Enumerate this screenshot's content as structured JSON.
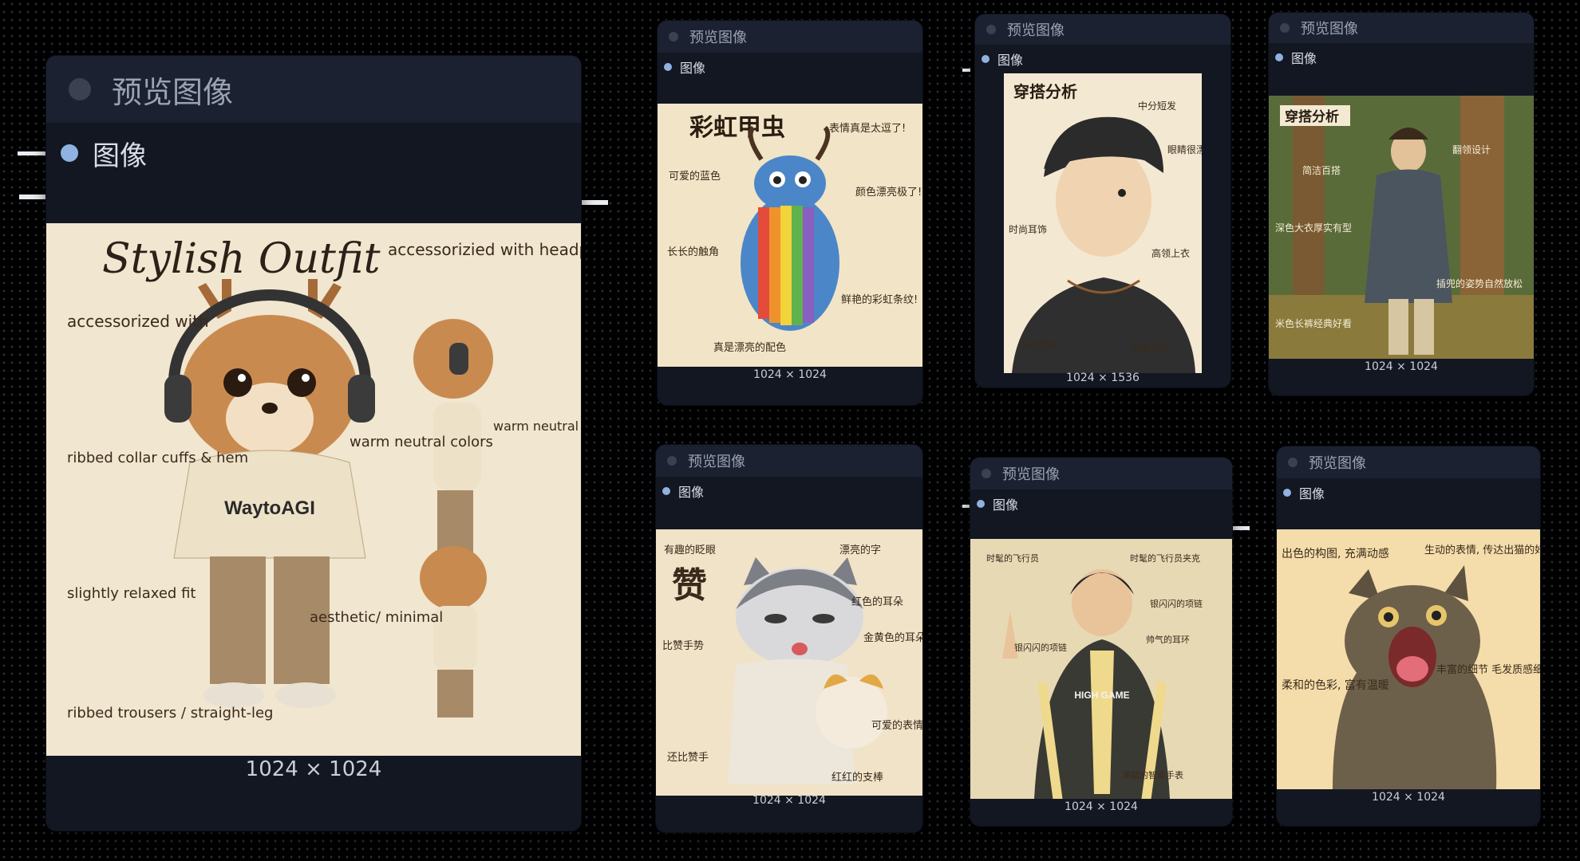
{
  "nodes": [
    {
      "title": "预览图像",
      "port_label": "图像",
      "size": "1024 × 1024",
      "image": {
        "title": "Stylish Outfit",
        "brand": "WaytoAGI",
        "notes": [
          "accessorizied with headphones",
          "accessorized with",
          "ribbed collar cuffs & hem",
          "warm neutral colors",
          "warm neutral colors",
          "slightly relaxed fit",
          "aesthetic/ minimal",
          "ribbed trousers / straight-leg"
        ]
      }
    },
    {
      "title": "预览图像",
      "port_label": "图像",
      "size": "1024 × 1024",
      "image": {
        "title": "彩虹甲虫",
        "notes": [
          "表情真是太逗了!",
          "可爱的蓝色",
          "颜色漂亮极了!",
          "长长的触角",
          "鲜艳的彩虹条纹!",
          "真是漂亮的配色"
        ]
      }
    },
    {
      "title": "预览图像",
      "port_label": "图像",
      "size": "1024 × 1536",
      "image": {
        "title": "穿搭分析",
        "notes": [
          "中分短发",
          "眼睛很漂亮",
          "时尚耳饰",
          "高领上衣",
          "时尚耳饰",
          "简单好看"
        ]
      }
    },
    {
      "title": "预览图像",
      "port_label": "图像",
      "size": "1024 × 1024",
      "image": {
        "title": "穿搭分析",
        "notes": [
          "翻领设计",
          "简洁百搭",
          "深色大衣厚实有型",
          "插兜的姿势自然放松",
          "米色长裤经典好看"
        ]
      }
    },
    {
      "title": "预览图像",
      "port_label": "图像",
      "size": "1024 × 1024",
      "image": {
        "big": "赞",
        "notes": [
          "有趣的眨眼",
          "漂亮的字",
          "红色的耳朵",
          "比赞手势",
          "金黄色的耳朵",
          "可爱的表情",
          "还比赞手",
          "红红的支棒"
        ]
      }
    },
    {
      "title": "预览图像",
      "port_label": "图像",
      "size": "1024 × 1024",
      "image": {
        "shirt": "HIGH GAME",
        "notes": [
          "时髦的飞行员",
          "时髦的飞行员夹克",
          "银闪闪的项链",
          "帅气的耳环",
          "银闪闪的项链",
          "潮酷的智能手表"
        ]
      }
    },
    {
      "title": "预览图像",
      "port_label": "图像",
      "size": "1024 × 1024",
      "image": {
        "notes": [
          "出色的构图, 充满动感",
          "生动的表情, 传达出猫的好奇与贪吃",
          "柔和的色彩, 富有温暖",
          "丰富的细节 毛发质感细腻"
        ]
      }
    }
  ],
  "colors": {
    "canvas": "#000000",
    "node_bg": "#121722",
    "node_header": "#1b2130",
    "port_dot": "#8fb2e0",
    "paper": "#f1e6cf"
  }
}
